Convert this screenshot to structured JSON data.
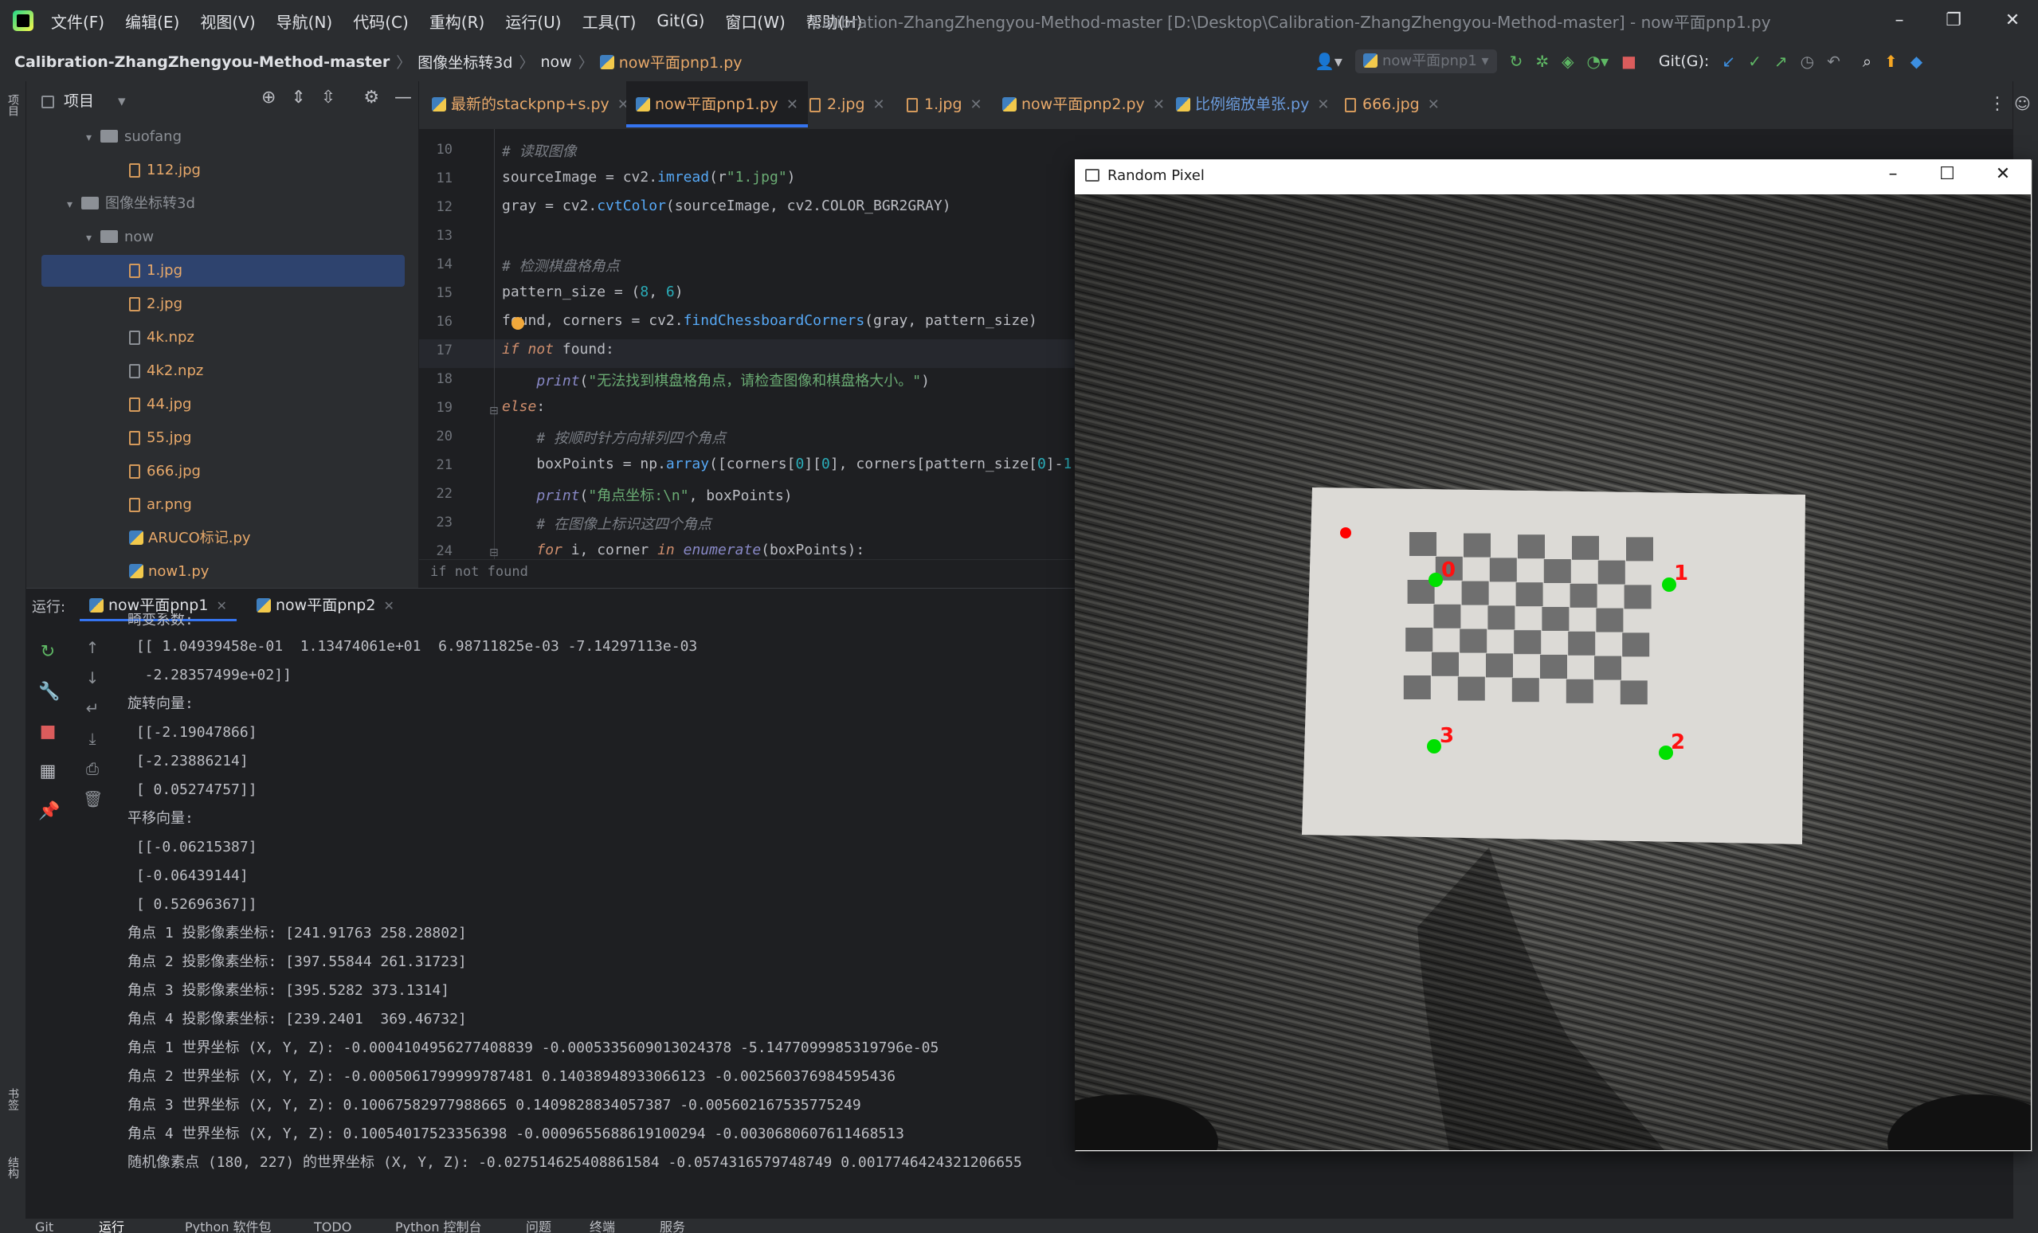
{
  "menu": [
    "文件(F)",
    "编辑(E)",
    "视图(V)",
    "导航(N)",
    "代码(C)",
    "重构(R)",
    "运行(U)",
    "工具(T)",
    "Git(G)",
    "窗口(W)",
    "帮助(H)"
  ],
  "window_title": "Calibration-ZhangZhengyou-Method-master [D:\\Desktop\\Calibration-ZhangZhengyou-Method-master] - now平面pnp1.py",
  "breadcrumb": {
    "project": "Calibration-ZhangZhengyou-Method-master",
    "folder": "图像坐标转3d",
    "sub": "now",
    "file": "now平面pnp1.py"
  },
  "toolbar": {
    "run_config": "now平面pnp1",
    "git_label": "Git(G):"
  },
  "project_panel": {
    "title": "项目",
    "tree": [
      {
        "label": "suofang",
        "type": "folder"
      },
      {
        "label": "112.jpg",
        "type": "file"
      },
      {
        "label": "图像坐标转3d",
        "type": "folder"
      },
      {
        "label": "now",
        "type": "folder"
      },
      {
        "label": "1.jpg",
        "type": "file",
        "selected": true
      },
      {
        "label": "2.jpg",
        "type": "file"
      },
      {
        "label": "4k.npz",
        "type": "file"
      },
      {
        "label": "4k2.npz",
        "type": "file"
      },
      {
        "label": "44.jpg",
        "type": "file"
      },
      {
        "label": "55.jpg",
        "type": "file"
      },
      {
        "label": "666.jpg",
        "type": "file"
      },
      {
        "label": "ar.png",
        "type": "file"
      },
      {
        "label": "ARUCO标记.py",
        "type": "file"
      },
      {
        "label": "now1.py",
        "type": "file"
      }
    ]
  },
  "left_strip": {
    "project": "项目",
    "bookmarks": "书签",
    "structure": "结构"
  },
  "editor_tabs": [
    {
      "label": "最新的stackpnp+s.py"
    },
    {
      "label": "now平面pnp1.py",
      "active": true
    },
    {
      "label": "2.jpg"
    },
    {
      "label": "1.jpg"
    },
    {
      "label": "now平面pnp2.py"
    },
    {
      "label": "比例缩放单张.py"
    },
    {
      "label": "666.jpg"
    }
  ],
  "editor": {
    "line_numbers": [
      "10",
      "11",
      "12",
      "13",
      "14",
      "15",
      "16",
      "17",
      "18",
      "19",
      "20",
      "21",
      "22",
      "23",
      "24"
    ],
    "status_hint": "if not found"
  },
  "run_panel": {
    "label": "运行:",
    "tabs": [
      "now平面pnp1",
      "now平面pnp2"
    ],
    "console": [
      "畸变系数:",
      " [[ 1.04939458e-01  1.13474061e+01  6.98711825e-03 -7.14297113e-03",
      "  -2.28357499e+02]]",
      "旋转向量:",
      " [[-2.19047866]",
      " [-2.23886214]",
      " [ 0.05274757]]",
      "平移向量:",
      " [[-0.06215387]",
      " [-0.06439144]",
      " [ 0.52696367]]",
      "角点 1 投影像素坐标: [241.91763 258.28802]",
      "角点 2 投影像素坐标: [397.55844 261.31723]",
      "角点 3 投影像素坐标: [395.5282 373.1314]",
      "角点 4 投影像素坐标: [239.2401  369.46732]",
      "角点 1 世界坐标 (X, Y, Z): -0.0004104956277408839 -0.0005335609013024378 -5.1477099985319796e-05",
      "角点 2 世界坐标 (X, Y, Z): -0.0005061799999787481 0.14038948933066123 -0.002560376984595436",
      "角点 3 世界坐标 (X, Y, Z): 0.10067582977988665 0.1409828834057387 -0.005602167535775249",
      "角点 4 世界坐标 (X, Y, Z): 0.10054017523356398 -0.0009655688619100294 -0.0030680607611468513",
      "随机像素点 (180, 227) 的世界坐标 (X, Y, Z): -0.027514625408861584 -0.0574316579748749 0.0017746424321206655"
    ]
  },
  "bottom_bar": [
    "Git",
    "运行",
    "Python 软件包",
    "TODO",
    "Python 控制台",
    "问题",
    "终端",
    "服务"
  ],
  "cv_window": {
    "title": "Random Pixel",
    "corner_labels": [
      "0",
      "1",
      "2",
      "3"
    ]
  },
  "colors": {
    "accent": "#3574f0",
    "file": "#e8a96a",
    "keyword": "#cf8e6d",
    "string": "#6aab73",
    "number": "#2aacb8",
    "function": "#56a8f5"
  }
}
